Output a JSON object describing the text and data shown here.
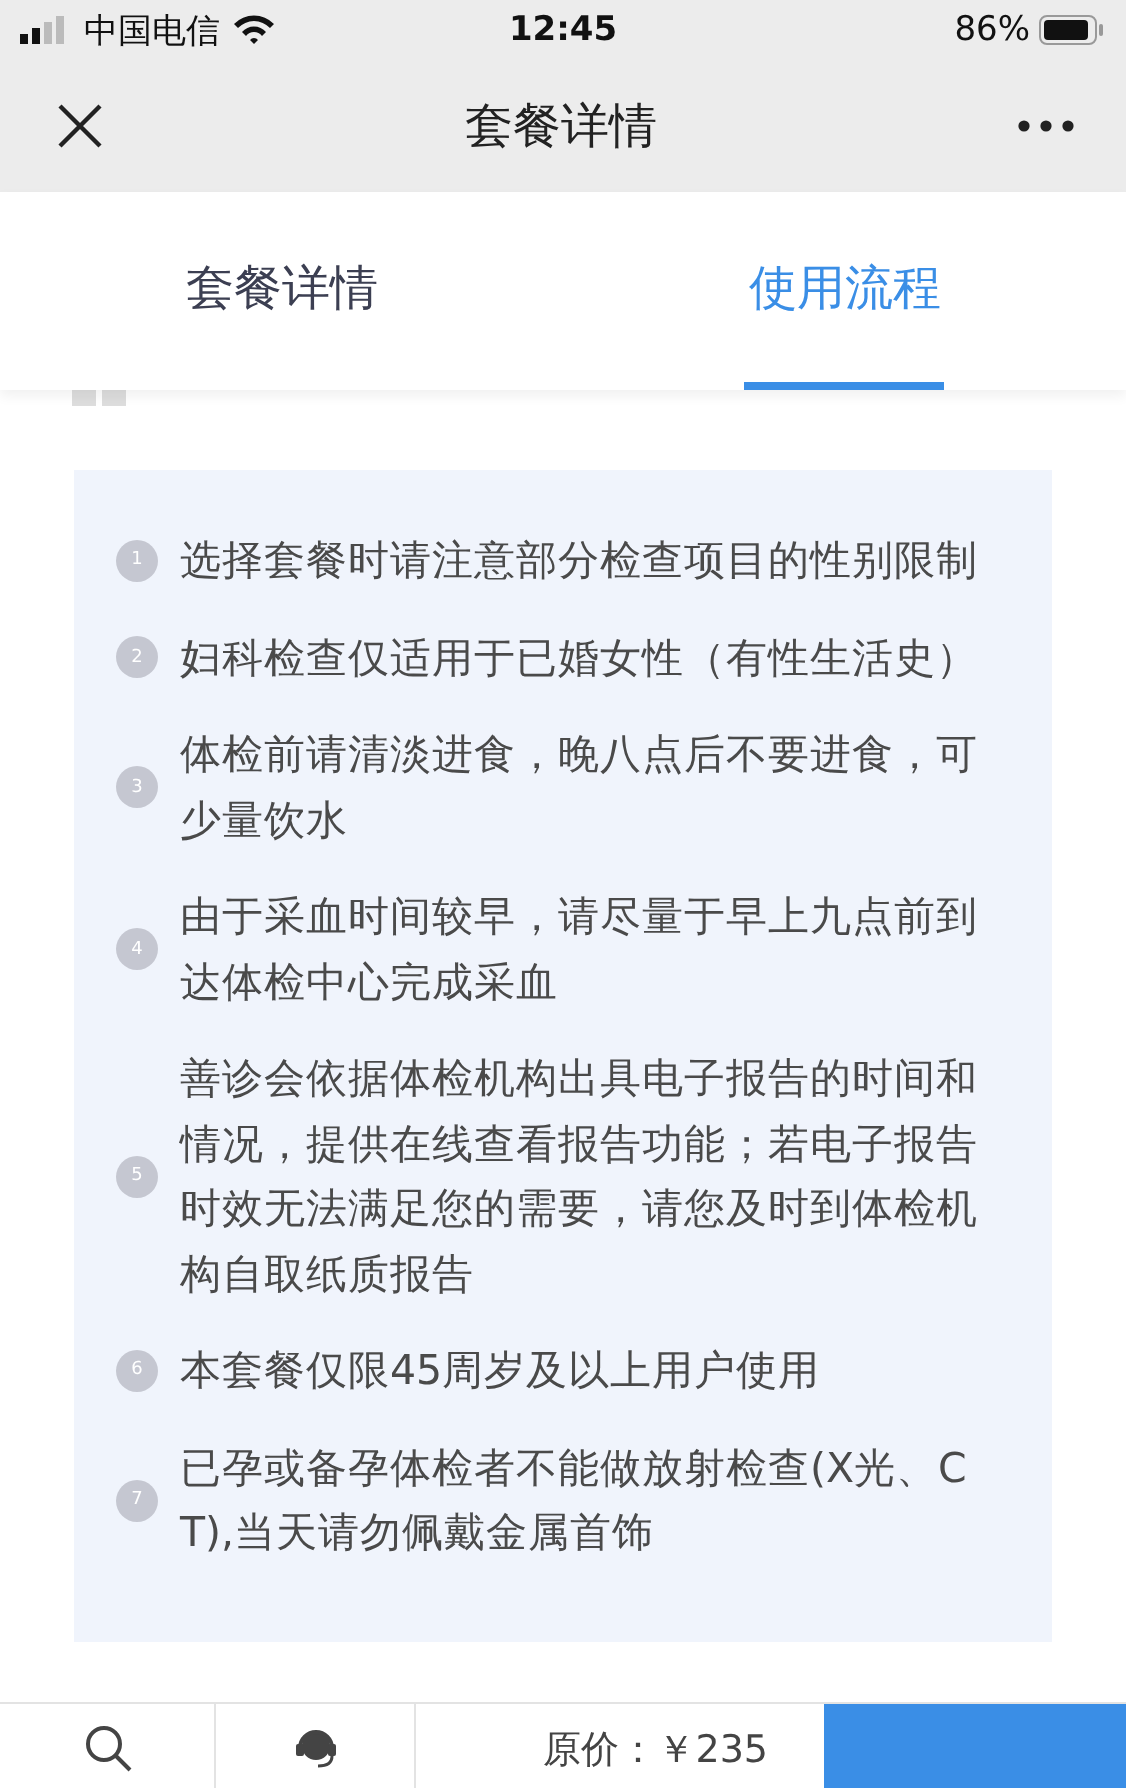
{
  "status_bar": {
    "carrier": "中国电信",
    "time": "12:45",
    "battery": "86%"
  },
  "header": {
    "title": "套餐详情"
  },
  "tabs": [
    {
      "label": "套餐详情",
      "selected": false
    },
    {
      "label": "使用流程",
      "selected": true
    }
  ],
  "notes": [
    {
      "number": "1",
      "text": "选择套餐时请注意部分检查项目的性别限制"
    },
    {
      "number": "2",
      "text": "妇科检查仅适用于已婚女性（有性生活史）"
    },
    {
      "number": "3",
      "text": "体检前请清淡进食，晚八点后不要进食，可少量饮水"
    },
    {
      "number": "4",
      "text": "由于采血时间较早，请尽量于早上九点前到达体检中心完成采血"
    },
    {
      "number": "5",
      "text": "善诊会依据体检机构出具电子报告的时间和情况，提供在线查看报告功能；若电子报告时效无法满足您的需要，请您及时到体检机构自取纸质报告"
    },
    {
      "number": "6",
      "text": "本套餐仅限45周岁及以上用户使用"
    },
    {
      "number": "7",
      "text": "已孕或备孕体检者不能做放射检查(X光、CT),当天请勿佩戴金属首饰"
    }
  ],
  "bottom_bar": {
    "price": "原价：￥235"
  }
}
